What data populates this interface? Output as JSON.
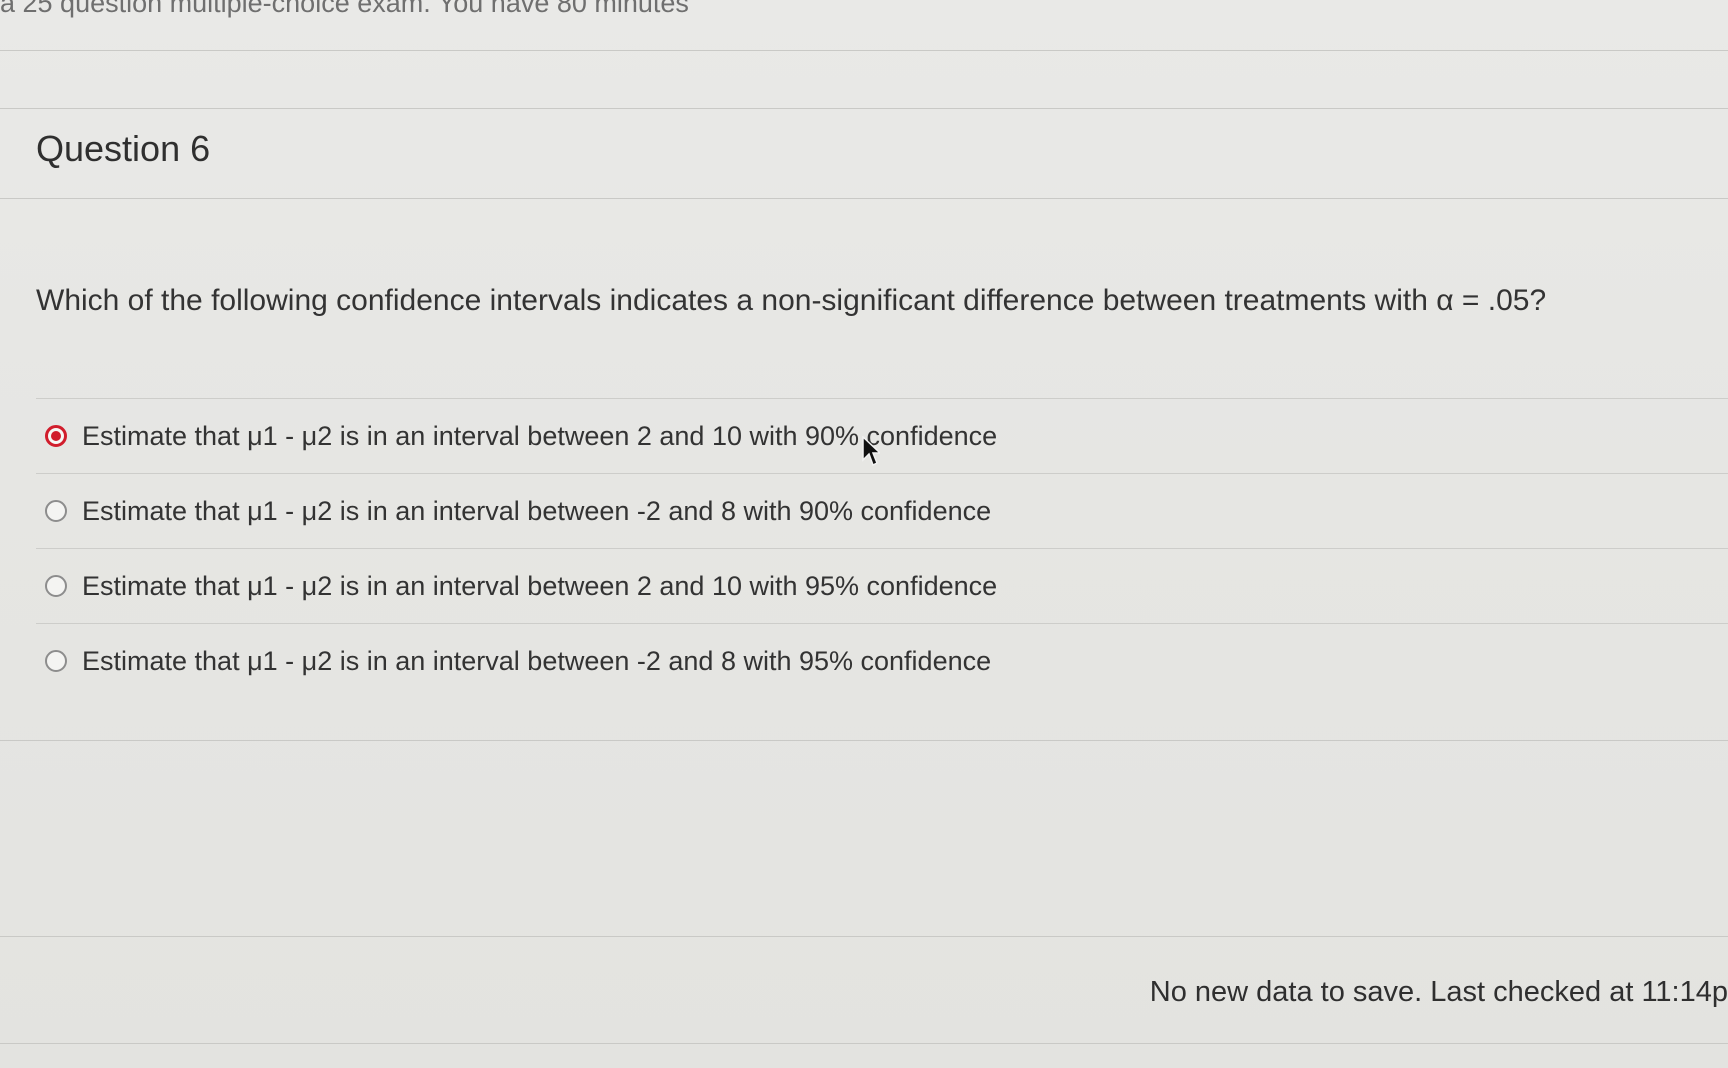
{
  "header": {
    "exam_note": "a 25 question multiple-choice exam. You have 80 minutes"
  },
  "question": {
    "title": "Question 6",
    "prompt": "Which of the following confidence intervals indicates a non-significant difference between treatments with α = .05?",
    "choices": [
      {
        "label": "Estimate that μ1 - μ2 is in an interval between 2 and 10 with 90% confidence",
        "selected": true
      },
      {
        "label": "Estimate that μ1 - μ2 is in an interval between -2 and 8 with 90% confidence",
        "selected": false
      },
      {
        "label": "Estimate that μ1 - μ2 is in an interval between 2 and 10 with 95% confidence",
        "selected": false
      },
      {
        "label": "Estimate that μ1 - μ2 is in an interval between -2 and 8 with 95% confidence",
        "selected": false
      }
    ]
  },
  "footer": {
    "save_status": "No new data to save. Last checked at 11:14p"
  },
  "colors": {
    "selected_radio": "#d11d2c",
    "background": "#e7e7e4",
    "text": "#333333"
  },
  "icons": {
    "cursor": "mouse-pointer-icon"
  }
}
